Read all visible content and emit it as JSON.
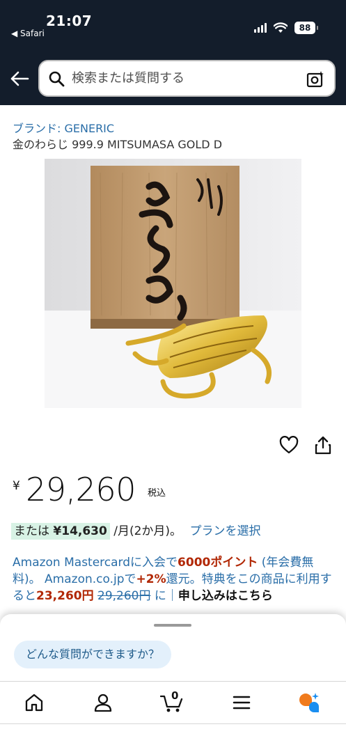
{
  "status_bar": {
    "time": "21:07",
    "back_app": "◀ Safari",
    "battery": "88"
  },
  "search": {
    "placeholder": "検索または質問する"
  },
  "product": {
    "brand": "ブランド: GENERIC",
    "title": "金のわらじ 999.9 MITSUMASA GOLD D",
    "image_alt": "金のわらじ"
  },
  "price": {
    "currency": "¥",
    "amount": "29,260",
    "tax_note": "税込"
  },
  "installment": {
    "prefix": "または",
    "amount": "¥14,630",
    "term": " /月(2か月)。",
    "plan_link": "プランを選択"
  },
  "card_promo": {
    "part1": "Amazon Mastercardに入会で",
    "points": "6000ポイント",
    "part2": " (年会費無料)。 Amazon.co.jpで",
    "pct": "+2%",
    "part3": "還元。特典をこの商品に利用すると",
    "discounted": "23,260円",
    "original": "29,260円",
    "part4": " に｜",
    "apply": "申し込みはこちら"
  },
  "sheet": {
    "ask_chip": "どんな質問ができますか？"
  },
  "tabbar": {
    "items": [
      "home-icon",
      "account-icon",
      "cart-icon",
      "menu-icon",
      "rufus-icon"
    ],
    "cart_count": "0"
  },
  "colors": {
    "header_bg": "#131d2b",
    "link": "#2a6ea8",
    "deal_red": "#b12704",
    "installment_bg": "#d8f2e5",
    "chip_bg": "#e3f0fb",
    "rufus_orange": "#f07b1d",
    "rufus_blue": "#1a8ef0"
  }
}
